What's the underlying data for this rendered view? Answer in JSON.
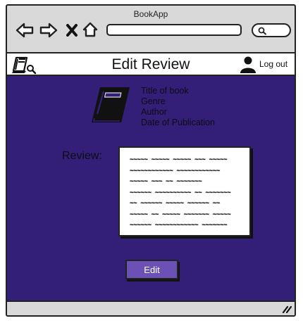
{
  "window": {
    "app_title": "BookApp"
  },
  "browser": {
    "icons": [
      "back-arrow-icon",
      "forward-arrow-icon",
      "close-icon",
      "home-icon",
      "search-icon"
    ],
    "url_value": ""
  },
  "header": {
    "title": "Edit Review",
    "logout_label": "Log out",
    "icons": [
      "book-search-logo-icon",
      "user-icon"
    ]
  },
  "book": {
    "title": "Title of book",
    "genre": "Genre",
    "author": "Author",
    "date": "Date of Publication",
    "icon": "book-icon"
  },
  "review": {
    "label": "Review:",
    "text": "~~~~~ ~~~~~ ~~~~~ ~~~ ~~~~~\n~~~~~~~~~~~~ ~~~~~~~~~~~~\n~~~~~ ~~~ ~~ ~~~~~~~\n~~~~~~ ~~~~~~~~~~ ~~ ~~~~~~~\n~~ ~~~~~~ ~~~~~ ~~~~~~ ~~\n~~~~~ ~~ ~~~~~ ~~~~~~~ ~~~~~\n~~~~~~ ~~~~~~~~~~~~ ~~~~~~~"
  },
  "actions": {
    "edit_label": "Edit"
  },
  "colors": {
    "content_bg": "#331f78",
    "button_bg": "#6b51b5",
    "chrome_bg": "#d9d9d9"
  }
}
